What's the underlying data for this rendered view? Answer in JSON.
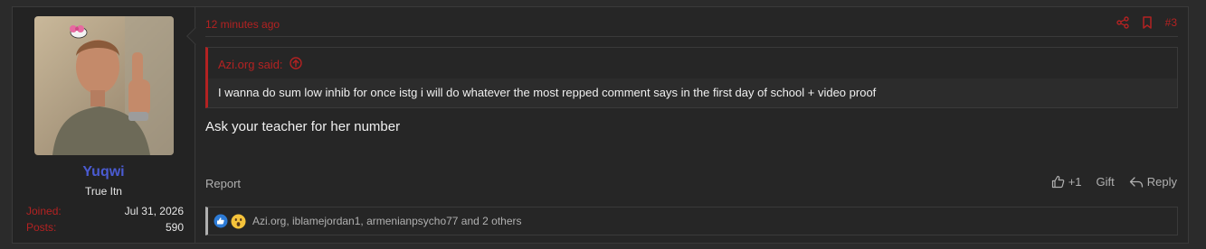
{
  "user": {
    "name": "Yuqwi",
    "title": "True Itn",
    "stats": [
      {
        "label": "Joined:",
        "value": "Jul 31, 2026"
      },
      {
        "label": "Posts:",
        "value": "590"
      }
    ]
  },
  "post": {
    "time": "12 minutes ago",
    "number": "#3",
    "quote": {
      "author": "Azi.org said:",
      "text": "I wanna do sum low inhib for once istg i will do whatever the most repped comment says in the first day of school + video proof"
    },
    "message": "Ask your teacher for her number",
    "footer": {
      "report": "Report",
      "like_count": "+1",
      "gift": "Gift",
      "reply": "Reply"
    },
    "reactions": {
      "icons": [
        "like-reaction-icon",
        "wow-reaction-icon"
      ],
      "users_text": "Azi.org, iblamejordan1, armenianpsycho77 and 2 others"
    }
  },
  "colors": {
    "accent": "#b32222",
    "username": "#4a5bd1",
    "background": "#262626"
  }
}
